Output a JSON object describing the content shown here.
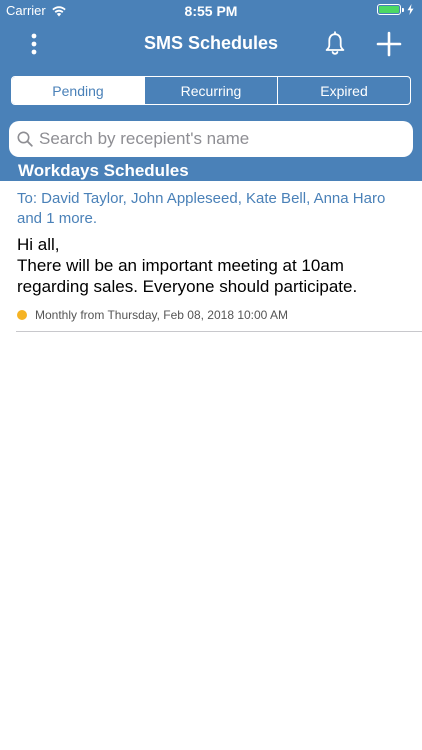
{
  "status_bar": {
    "carrier": "Carrier",
    "time": "8:55 PM"
  },
  "nav": {
    "title": "SMS Schedules",
    "menu_icon": "more-vertical-icon",
    "bell_icon": "bell-icon",
    "add_icon": "plus-icon"
  },
  "tabs": [
    {
      "label": "Pending",
      "active": true
    },
    {
      "label": "Recurring",
      "active": false
    },
    {
      "label": "Expired",
      "active": false
    }
  ],
  "search": {
    "placeholder": "Search by recepient's name",
    "value": ""
  },
  "section": {
    "title": "Workdays Schedules"
  },
  "schedule": {
    "recipients": "To: David Taylor, John Appleseed, Kate Bell, Anna Haro and 1 more.",
    "message": "Hi all,\nThere will be an important meeting at 10am regarding sales. Everyone should participate.",
    "schedule_text": "Monthly from Thursday, Feb 08, 2018 10:00 AM",
    "status_color": "#f5b324"
  },
  "colors": {
    "brand": "#4a81b8",
    "battery": "#4cd964"
  }
}
